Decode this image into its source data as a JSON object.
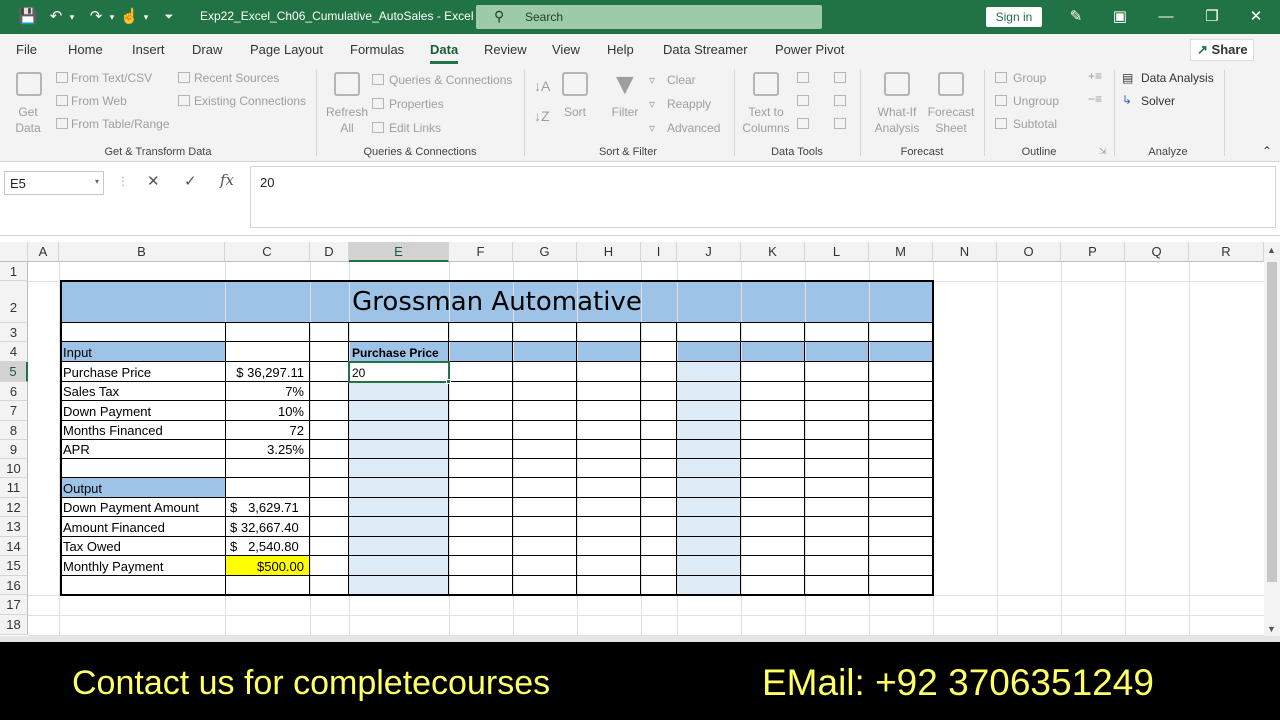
{
  "titlebar": {
    "doc_title": "Exp22_Excel_Ch06_Cumulative_AutoSales  -  Excel",
    "search_placeholder": "Search",
    "signin": "Sign in"
  },
  "menu": {
    "tabs": [
      "File",
      "Home",
      "Insert",
      "Draw",
      "Page Layout",
      "Formulas",
      "Data",
      "Review",
      "View",
      "Help",
      "Data Streamer",
      "Power Pivot"
    ],
    "active": "Data",
    "share": "Share"
  },
  "ribbon": {
    "get_data": "Get\nData",
    "from_text": "From Text/CSV",
    "from_web": "From Web",
    "from_table": "From Table/Range",
    "recent": "Recent Sources",
    "existing": "Existing Connections",
    "group1": "Get & Transform Data",
    "refresh": "Refresh\nAll",
    "queries": "Queries & Connections",
    "properties": "Properties",
    "edit_links": "Edit Links",
    "group2": "Queries & Connections",
    "sort": "Sort",
    "filter": "Filter",
    "clear": "Clear",
    "reapply": "Reapply",
    "advanced": "Advanced",
    "group3": "Sort & Filter",
    "text_to_columns": "Text to\nColumns",
    "group4": "Data Tools",
    "whatif": "What-If\nAnalysis",
    "forecast_sheet": "Forecast\nSheet",
    "group5": "Forecast",
    "group_btn": "Group",
    "ungroup": "Ungroup",
    "subtotal": "Subtotal",
    "group6": "Outline",
    "data_analysis": "Data Analysis",
    "solver": "Solver",
    "group7": "Analyze"
  },
  "formula": {
    "name_box": "E5",
    "value": "20"
  },
  "columns": [
    "A",
    "B",
    "C",
    "D",
    "E",
    "F",
    "G",
    "H",
    "I",
    "J",
    "K",
    "L",
    "M",
    "N",
    "O",
    "P",
    "Q",
    "R"
  ],
  "rows": [
    "1",
    "2",
    "3",
    "4",
    "5",
    "6",
    "7",
    "8",
    "9",
    "10",
    "11",
    "12",
    "13",
    "14",
    "15",
    "16",
    "17",
    "18"
  ],
  "sheet": {
    "title": "Grossman Automative",
    "input_header": "Input",
    "inputs": [
      {
        "label": "Purchase Price",
        "value": "$ 36,297.11"
      },
      {
        "label": "Sales Tax",
        "value": "7%"
      },
      {
        "label": "Down Payment",
        "value": "10%"
      },
      {
        "label": "Months Financed",
        "value": "72"
      },
      {
        "label": "APR",
        "value": "3.25%"
      }
    ],
    "output_header": "Output",
    "outputs": [
      {
        "label": "Down Payment Amount",
        "value": "$   3,629.71"
      },
      {
        "label": "Amount Financed",
        "value": "$ 32,667.40"
      },
      {
        "label": "Tax Owed",
        "value": "$   2,540.80"
      },
      {
        "label": "Monthly Payment",
        "value": "$500.00"
      }
    ],
    "e4": "Purchase Price",
    "e5": "20"
  },
  "banner": {
    "left": "Contact us for completecourses",
    "right": "EMail: +92 3706351249"
  },
  "colors": {
    "excel_green": "#217346",
    "header_blue": "#9dc3e6",
    "light_blue": "#ddebf7",
    "highlight": "#ffff00"
  }
}
